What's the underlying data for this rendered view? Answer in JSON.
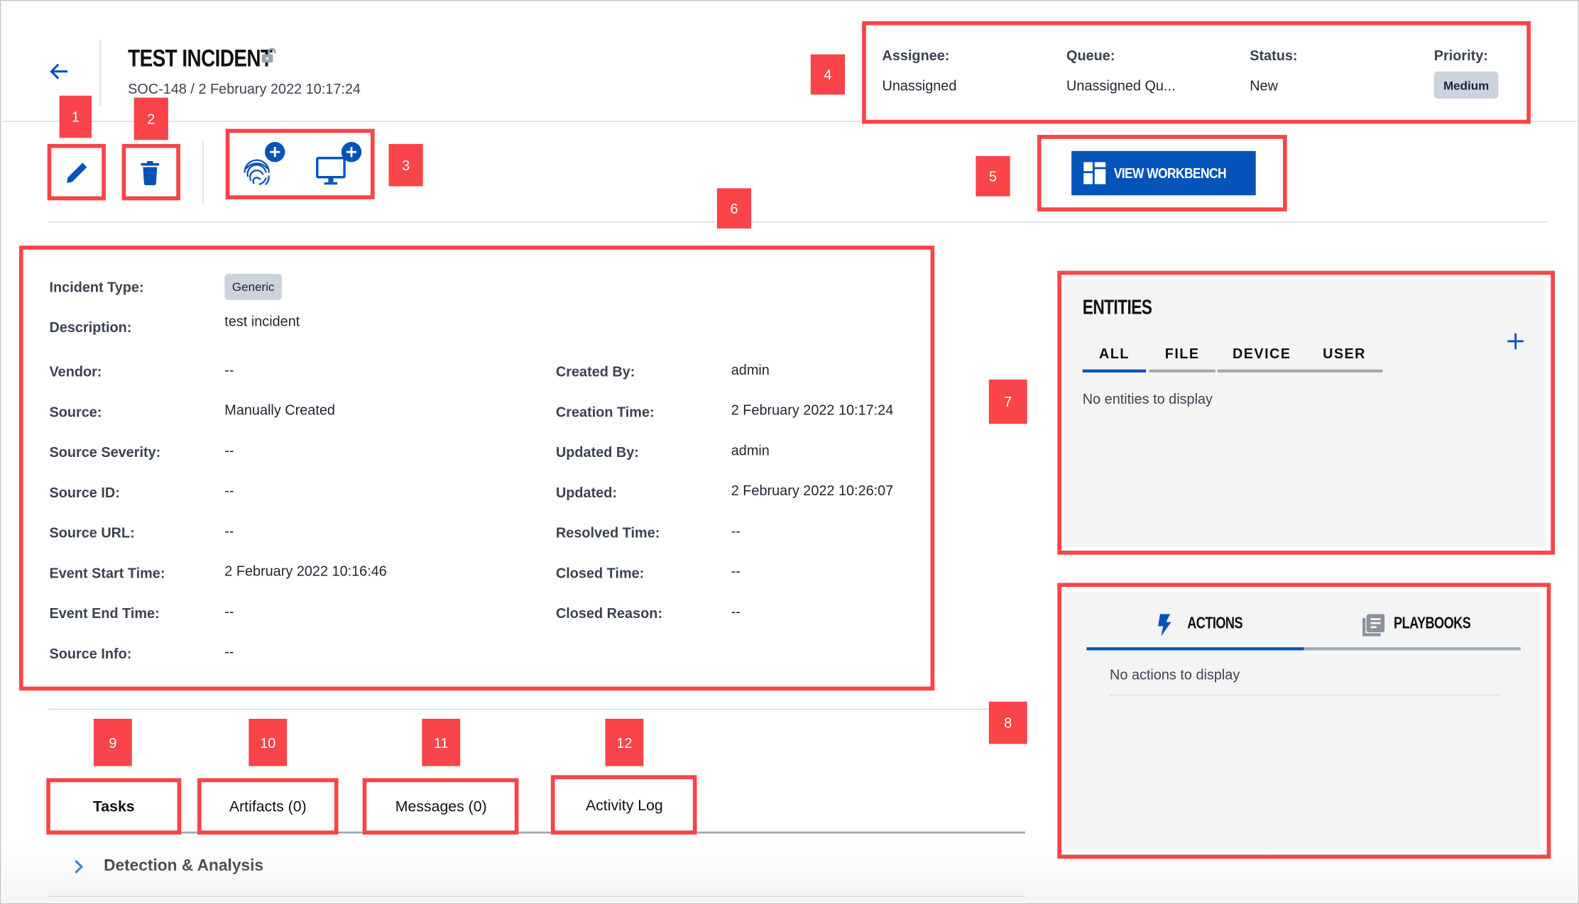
{
  "header": {
    "title": "TEST INCIDENT",
    "subtitle": "SOC-148 / 2 February 2022 10:17:24",
    "back_icon": "arrow-left-icon",
    "lock_icon": "unlock-icon"
  },
  "summary": {
    "assignee_label": "Assignee:",
    "assignee_value": "Unassigned",
    "queue_label": "Queue:",
    "queue_value": "Unassigned Qu...",
    "status_label": "Status:",
    "status_value": "New",
    "priority_label": "Priority:",
    "priority_value": "Medium"
  },
  "toolbar": {
    "edit_icon": "pencil-icon",
    "delete_icon": "trash-icon",
    "add_fingerprint_icon": "fingerprint-plus-icon",
    "add_device_icon": "monitor-plus-icon",
    "view_workbench_label": "VIEW WORKBENCH"
  },
  "details": {
    "left": [
      {
        "label": "Incident Type:",
        "value": "Generic",
        "badge": true
      },
      {
        "label": "Description:",
        "value": "test incident"
      },
      {
        "label": "Vendor:",
        "value": "--"
      },
      {
        "label": "Source:",
        "value": "Manually Created"
      },
      {
        "label": "Source Severity:",
        "value": "--"
      },
      {
        "label": "Source ID:",
        "value": "--"
      },
      {
        "label": "Source URL:",
        "value": "--"
      },
      {
        "label": "Event Start Time:",
        "value": "2 February 2022 10:16:46"
      },
      {
        "label": "Event End Time:",
        "value": "--"
      },
      {
        "label": "Source Info:",
        "value": "--"
      }
    ],
    "right": [
      {
        "label": "Created By:",
        "value": "admin"
      },
      {
        "label": "Creation Time:",
        "value": "2 February 2022 10:17:24"
      },
      {
        "label": "Updated By:",
        "value": "admin"
      },
      {
        "label": "Updated:",
        "value": "2 February 2022 10:26:07"
      },
      {
        "label": "Resolved Time:",
        "value": "--"
      },
      {
        "label": "Closed Time:",
        "value": "--"
      },
      {
        "label": "Closed Reason:",
        "value": "--"
      }
    ]
  },
  "entities": {
    "title": "ENTITIES",
    "tabs": [
      "ALL",
      "FILE",
      "DEVICE",
      "USER"
    ],
    "active_tab": "ALL",
    "empty_text": "No entities to display",
    "add_icon": "plus-icon"
  },
  "actions_panel": {
    "tabs": [
      {
        "label": "ACTIONS",
        "icon": "lightning-icon"
      },
      {
        "label": "PLAYBOOKS",
        "icon": "playbook-icon"
      }
    ],
    "active_tab": "ACTIONS",
    "empty_text": "No actions to display"
  },
  "bottom_tabs": {
    "tabs": [
      "Tasks",
      "Artifacts (0)",
      "Messages (0)",
      "Activity Log"
    ],
    "active_tab": "Tasks"
  },
  "task_section": {
    "expand_icon": "chevron-right-icon",
    "title": "Detection & Analysis"
  },
  "annotations": [
    "1",
    "2",
    "3",
    "4",
    "5",
    "6",
    "7",
    "8",
    "9",
    "10",
    "11",
    "12"
  ],
  "colors": {
    "accent": "#0353b8",
    "annotation": "#f94449",
    "badge_bg": "#ccd3dd",
    "panel_bg": "#f4f4f4"
  }
}
